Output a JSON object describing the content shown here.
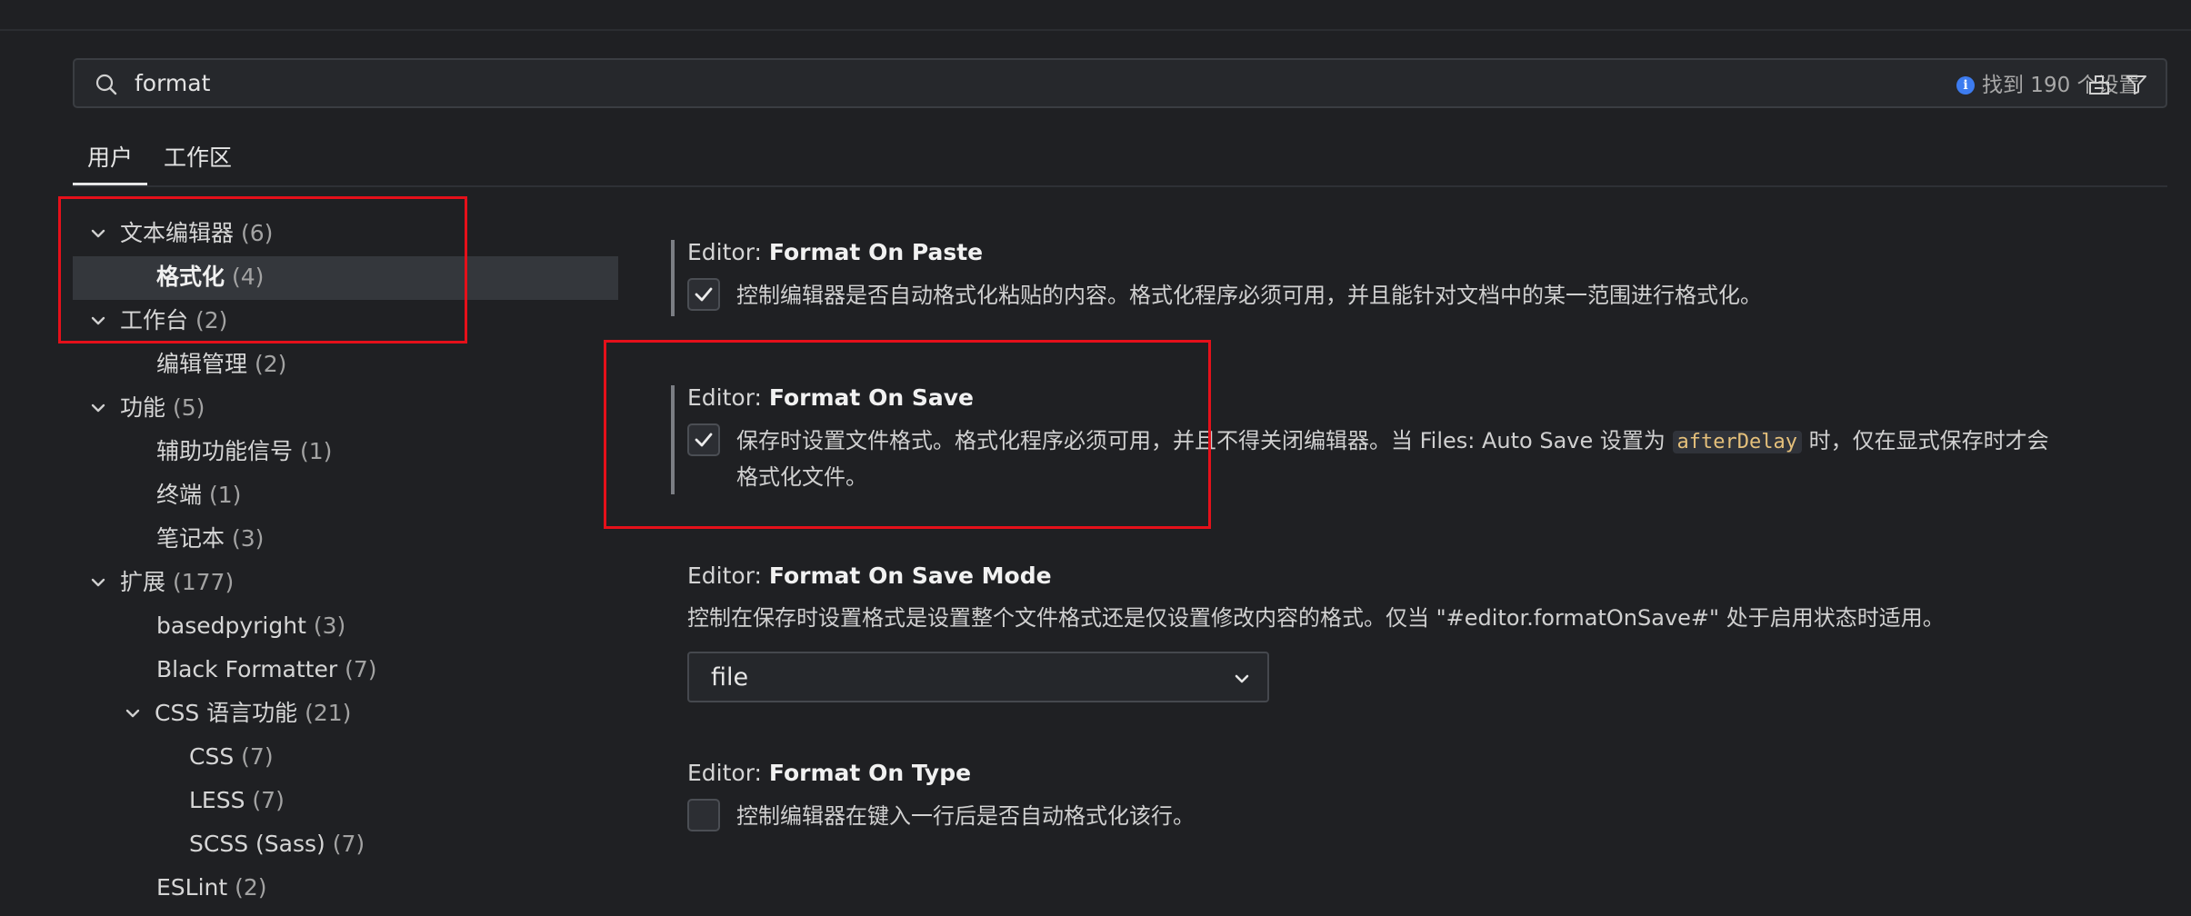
{
  "search": {
    "value": "format",
    "result_count": "找到 190 个设置",
    "icons": [
      "search-icon",
      "info-icon",
      "clear-filter-icon",
      "filter-icon"
    ]
  },
  "tabs": [
    {
      "label": "用户",
      "active": true
    },
    {
      "label": "工作区",
      "active": false
    }
  ],
  "tree": [
    {
      "label": "文本编辑器",
      "count": "(6)",
      "expanded": true
    },
    {
      "label": "格式化",
      "count": "(4)",
      "selected": true
    },
    {
      "label": "工作台",
      "count": "(2)",
      "expanded": true
    },
    {
      "label": "编辑管理",
      "count": "(2)"
    },
    {
      "label": "功能",
      "count": "(5)",
      "expanded": true
    },
    {
      "label": "辅助功能信号",
      "count": "(1)"
    },
    {
      "label": "终端",
      "count": "(1)"
    },
    {
      "label": "笔记本",
      "count": "(3)"
    },
    {
      "label": "扩展",
      "count": "(177)",
      "expanded": true
    },
    {
      "label": "basedpyright",
      "count": "(3)"
    },
    {
      "label": "Black Formatter",
      "count": "(7)"
    },
    {
      "label": "CSS 语言功能",
      "count": "(21)",
      "expanded": true
    },
    {
      "label": "CSS",
      "count": "(7)"
    },
    {
      "label": "LESS",
      "count": "(7)"
    },
    {
      "label": "SCSS (Sass)",
      "count": "(7)"
    },
    {
      "label": "ESLint",
      "count": "(2)"
    }
  ],
  "settings": {
    "paste": {
      "prefix": "Editor: ",
      "name": "Format On Paste",
      "checked": true,
      "description": "控制编辑器是否自动格式化粘贴的内容。格式化程序必须可用，并且能针对文档中的某一范围进行格式化。"
    },
    "save": {
      "prefix": "Editor: ",
      "name": "Format On Save",
      "checked": true,
      "desc_before": "保存时设置文件格式。格式化程序必须可用，并且不得关闭编辑器。当 Files: Auto Save 设置为 ",
      "desc_code": "afterDelay",
      "desc_after_line1": " 时，仅在显式保存时才会",
      "desc_line2": "格式化文件。"
    },
    "save_mode": {
      "prefix": "Editor: ",
      "name": "Format On Save Mode",
      "description": "控制在保存时设置格式是设置整个文件格式还是仅设置修改内容的格式。仅当 \"#editor.formatOnSave#\" 处于启用状态时适用。",
      "selected": "file"
    },
    "type": {
      "prefix": "Editor: ",
      "name": "Format On Type",
      "checked": false,
      "description": "控制编辑器在键入一行后是否自动格式化该行。"
    }
  },
  "colors": {
    "background": "#1f2023",
    "annotation_red": "#e5101a",
    "code_text": "#e5c07b",
    "info_blue": "#3d7cf0"
  }
}
